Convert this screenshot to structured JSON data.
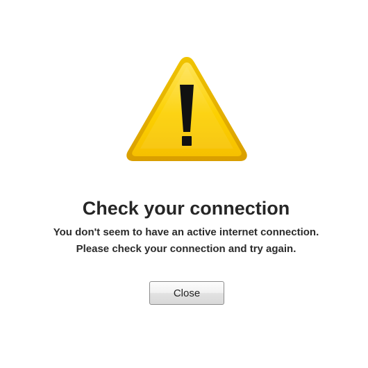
{
  "dialog": {
    "icon": "warning-triangle-icon",
    "title": "Check your connection",
    "message_line1": "You don't seem to have an active internet connection.",
    "message_line2": "Please check your connection and try again.",
    "close_label": "Close"
  },
  "colors": {
    "warning_yellow": "#fcc800",
    "warning_highlight": "#ffe45a",
    "warning_border": "#e1a800",
    "exclamation": "#111111"
  }
}
